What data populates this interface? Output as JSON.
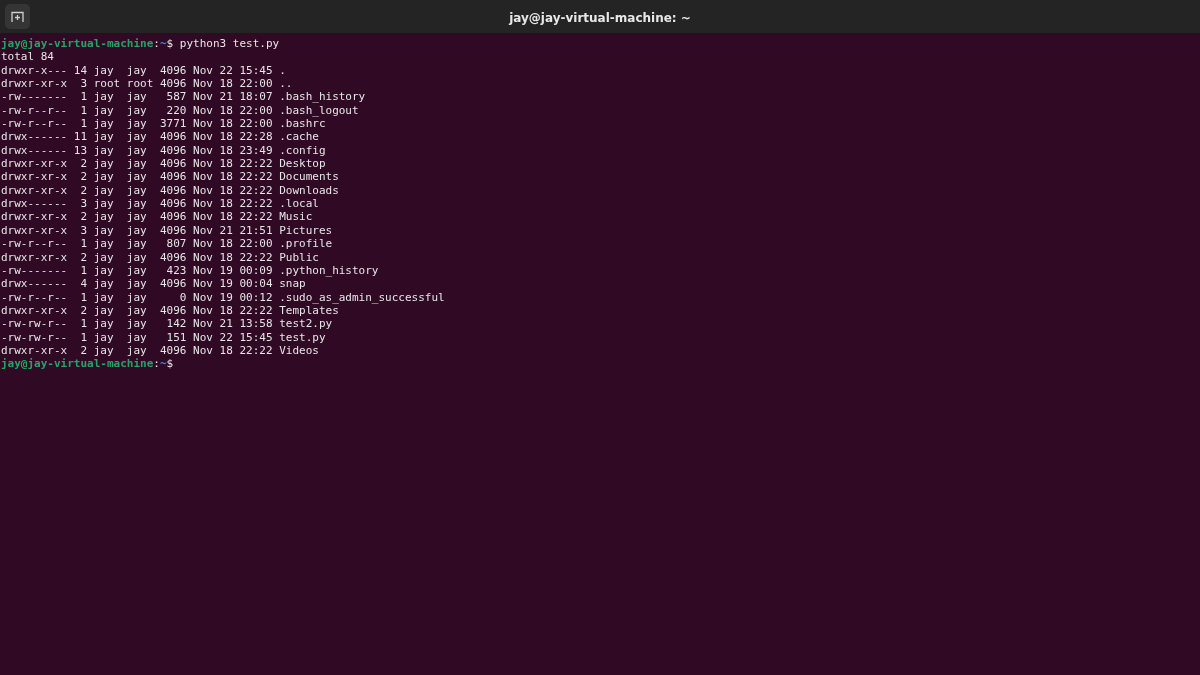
{
  "window": {
    "title": "jay@jay-virtual-machine: ~"
  },
  "terminal": {
    "lines": [
      {
        "kind": "prompt",
        "user_host": "jay@jay-virtual-machine",
        "separator": ":",
        "path": "~",
        "symbol": "$",
        "command": "python3 test.py"
      },
      {
        "kind": "output",
        "text": "total 84"
      },
      {
        "kind": "output",
        "text": "drwxr-x--- 14 jay  jay  4096 Nov 22 15:45 ."
      },
      {
        "kind": "output",
        "text": "drwxr-xr-x  3 root root 4096 Nov 18 22:00 .."
      },
      {
        "kind": "output",
        "text": "-rw-------  1 jay  jay   587 Nov 21 18:07 .bash_history"
      },
      {
        "kind": "output",
        "text": "-rw-r--r--  1 jay  jay   220 Nov 18 22:00 .bash_logout"
      },
      {
        "kind": "output",
        "text": "-rw-r--r--  1 jay  jay  3771 Nov 18 22:00 .bashrc"
      },
      {
        "kind": "output",
        "text": "drwx------ 11 jay  jay  4096 Nov 18 22:28 .cache"
      },
      {
        "kind": "output",
        "text": "drwx------ 13 jay  jay  4096 Nov 18 23:49 .config"
      },
      {
        "kind": "output",
        "text": "drwxr-xr-x  2 jay  jay  4096 Nov 18 22:22 Desktop"
      },
      {
        "kind": "output",
        "text": "drwxr-xr-x  2 jay  jay  4096 Nov 18 22:22 Documents"
      },
      {
        "kind": "output",
        "text": "drwxr-xr-x  2 jay  jay  4096 Nov 18 22:22 Downloads"
      },
      {
        "kind": "output",
        "text": "drwx------  3 jay  jay  4096 Nov 18 22:22 .local"
      },
      {
        "kind": "output",
        "text": "drwxr-xr-x  2 jay  jay  4096 Nov 18 22:22 Music"
      },
      {
        "kind": "output",
        "text": "drwxr-xr-x  3 jay  jay  4096 Nov 21 21:51 Pictures"
      },
      {
        "kind": "output",
        "text": "-rw-r--r--  1 jay  jay   807 Nov 18 22:00 .profile"
      },
      {
        "kind": "output",
        "text": "drwxr-xr-x  2 jay  jay  4096 Nov 18 22:22 Public"
      },
      {
        "kind": "output",
        "text": "-rw-------  1 jay  jay   423 Nov 19 00:09 .python_history"
      },
      {
        "kind": "output",
        "text": "drwx------  4 jay  jay  4096 Nov 19 00:04 snap"
      },
      {
        "kind": "output",
        "text": "-rw-r--r--  1 jay  jay     0 Nov 19 00:12 .sudo_as_admin_successful"
      },
      {
        "kind": "output",
        "text": "drwxr-xr-x  2 jay  jay  4096 Nov 18 22:22 Templates"
      },
      {
        "kind": "output",
        "text": "-rw-rw-r--  1 jay  jay   142 Nov 21 13:58 test2.py"
      },
      {
        "kind": "output",
        "text": "-rw-rw-r--  1 jay  jay   151 Nov 22 15:45 test.py"
      },
      {
        "kind": "output",
        "text": "drwxr-xr-x  2 jay  jay  4096 Nov 18 22:22 Videos"
      },
      {
        "kind": "prompt",
        "user_host": "jay@jay-virtual-machine",
        "separator": ":",
        "path": "~",
        "symbol": "$"
      }
    ]
  }
}
